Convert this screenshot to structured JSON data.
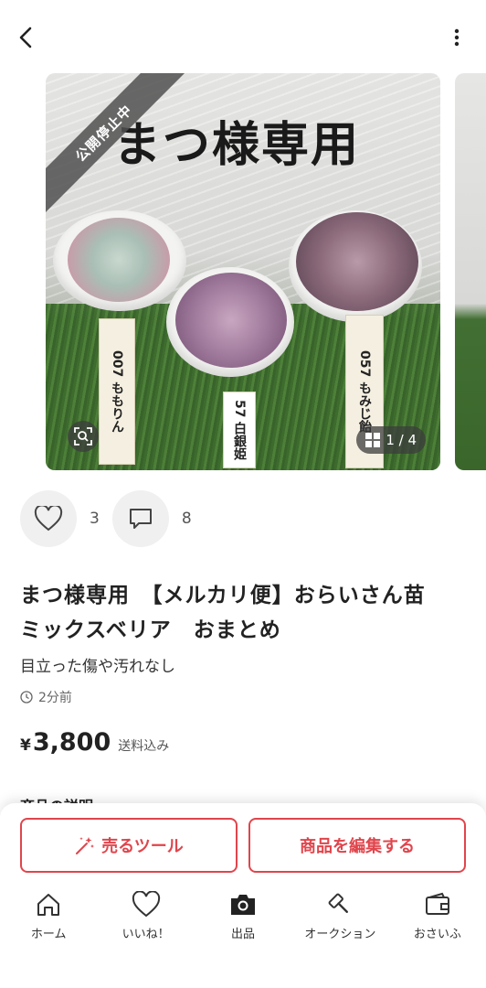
{
  "header": {
    "back_icon": "chevron-left-icon",
    "more_icon": "vertical-dots-icon"
  },
  "photo": {
    "overlay_title": "まつ様専用",
    "status_ribbon": "公開停止中",
    "tags": [
      "007 ももりん",
      "57 白銀姫",
      "057 もみじ飴"
    ],
    "counter": "1 / 4"
  },
  "social": {
    "likes": "3",
    "comments": "8"
  },
  "item": {
    "title": "まつ様専用　【メルカリ便】おらいさん苗　ミックスベリア　おまとめ",
    "condition": "目立った傷や汚れなし",
    "posted": "2分前",
    "currency": "¥",
    "price": "3,800",
    "shipping": "送料込み",
    "section_peek": "商品の説明"
  },
  "actions": {
    "sell_tool": "売るツール",
    "edit": "商品を編集する"
  },
  "nav": [
    {
      "label": "ホーム",
      "icon": "home-icon"
    },
    {
      "label": "いいね！",
      "icon": "heart-icon"
    },
    {
      "label": "出品",
      "icon": "camera-icon"
    },
    {
      "label": "オークション",
      "icon": "gavel-icon"
    },
    {
      "label": "おさいふ",
      "icon": "wallet-icon"
    }
  ],
  "colors": {
    "accent": "#e0454c",
    "text": "#222222",
    "muted": "#666666"
  }
}
